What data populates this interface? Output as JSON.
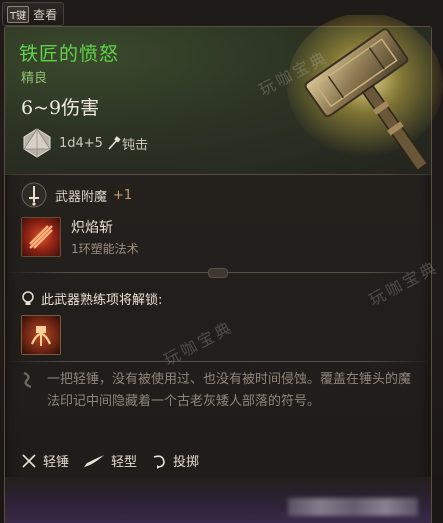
{
  "key_hint": {
    "key": "T键",
    "label": "查看"
  },
  "item": {
    "name": "铁匠的愤怒",
    "rarity": "精良",
    "damage": "6~9伤害",
    "dice": "1d4+5",
    "damage_type": "钝击"
  },
  "enchant": {
    "label": "武器附魔",
    "bonus": "+1"
  },
  "spell": {
    "name": "炽焰斩",
    "subtitle": "1环塑能法术"
  },
  "unlock": {
    "label": "此武器熟练项将解锁:"
  },
  "description": "一把轻锤，没有被使用过、也没有被时间侵蚀。覆盖在锤头的魔法印记中间隐藏着一个古老灰矮人部落的符号。",
  "properties": [
    {
      "label": "轻锤",
      "icon": "light-hammer-icon"
    },
    {
      "label": "轻型",
      "icon": "feather-icon"
    },
    {
      "label": "投掷",
      "icon": "throw-icon"
    }
  ],
  "watermarks": [
    "玩咖宝典",
    "玩咖宝典",
    "玩咖宝典"
  ],
  "colors": {
    "title": "#5fd44a",
    "rarity": "#8fbf6e",
    "bonus": "#c7a067"
  }
}
